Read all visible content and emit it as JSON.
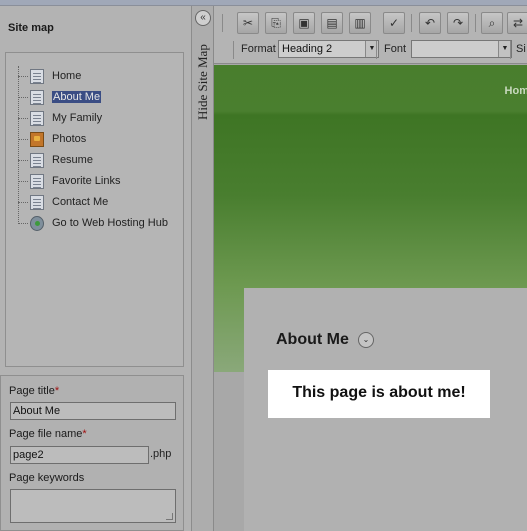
{
  "sidebar": {
    "title": "Site map",
    "items": [
      {
        "label": "Home",
        "icon": "page-icon",
        "selected": false
      },
      {
        "label": "About Me",
        "icon": "page-icon",
        "selected": true
      },
      {
        "label": "My Family",
        "icon": "page-icon",
        "selected": false
      },
      {
        "label": "Photos",
        "icon": "photos-icon",
        "selected": false
      },
      {
        "label": "Resume",
        "icon": "page-icon",
        "selected": false
      },
      {
        "label": "Favorite Links",
        "icon": "page-icon",
        "selected": false
      },
      {
        "label": "Contact Me",
        "icon": "page-icon",
        "selected": false
      },
      {
        "label": "Go to Web Hosting Hub",
        "icon": "web-hosting-hub-icon",
        "selected": false
      }
    ]
  },
  "properties": {
    "page_title_label": "Page title",
    "page_title_value": "About Me",
    "page_file_label": "Page file name",
    "page_file_value": "page2",
    "page_file_suffix": ".php",
    "keywords_label": "Page keywords",
    "required_marker": "*"
  },
  "hide_site_map": {
    "label": "Hide Site Map",
    "collapse_icon": "double-chevron-left-icon",
    "collapse_glyph": "«"
  },
  "toolbar": {
    "buttons": [
      {
        "name": "cut-button",
        "icon": "scissors-icon",
        "glyph": "✂"
      },
      {
        "name": "copy-button",
        "icon": "copy-icon",
        "glyph": "⎘"
      },
      {
        "name": "paste-button",
        "icon": "paste-icon",
        "glyph": "▣"
      },
      {
        "name": "paste-text-button",
        "icon": "paste-text-icon",
        "glyph": "▤"
      },
      {
        "name": "paste-word-button",
        "icon": "paste-word-icon",
        "glyph": "▥"
      },
      {
        "name": "spellcheck-button",
        "icon": "spellcheck-icon",
        "glyph": "✓"
      },
      {
        "name": "undo-button",
        "icon": "undo-icon",
        "glyph": "↶"
      },
      {
        "name": "redo-button",
        "icon": "redo-icon",
        "glyph": "↷"
      },
      {
        "name": "find-button",
        "icon": "binoculars-icon",
        "glyph": "⌕"
      },
      {
        "name": "replace-button",
        "icon": "replace-icon",
        "glyph": "⇄"
      }
    ],
    "format_label": "Format",
    "format_value": "Heading 2",
    "font_label": "Font",
    "font_value": "",
    "size_label": "Si"
  },
  "editor": {
    "nav_home": "Hom",
    "heading": "About Me",
    "heading_button_icon": "chevron-down-icon",
    "heading_button_glyph": "⌄",
    "callout": "This page is about me!"
  },
  "colors": {
    "header_green": "#4a7f2f",
    "selection": "#3a4d84",
    "required": "#a01010"
  }
}
